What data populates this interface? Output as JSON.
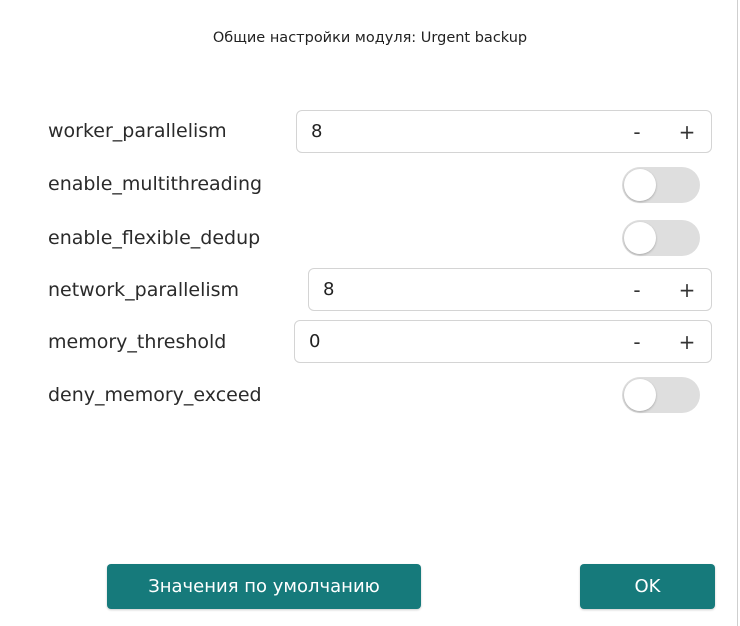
{
  "dialog": {
    "title": "Общие настройки модуля: Urgent backup"
  },
  "settings": [
    {
      "key": "worker_parallelism",
      "label": "worker_parallelism",
      "type": "stepper",
      "value": "8",
      "minus": "-",
      "plus": "+"
    },
    {
      "key": "enable_multithreading",
      "label": "enable_multithreading",
      "type": "toggle",
      "on": false
    },
    {
      "key": "enable_flexible_dedup",
      "label": "enable_flexible_dedup",
      "type": "toggle",
      "on": false
    },
    {
      "key": "network_parallelism",
      "label": "network_parallelism",
      "type": "stepper",
      "value": "8",
      "minus": "-",
      "plus": "+"
    },
    {
      "key": "memory_threshold",
      "label": "memory_threshold",
      "type": "stepper",
      "value": "0",
      "minus": "-",
      "plus": "+"
    },
    {
      "key": "deny_memory_exceed",
      "label": "deny_memory_exceed",
      "type": "toggle",
      "on": false
    }
  ],
  "buttons": {
    "defaults_label": "Значения по умолчанию",
    "ok_label": "OK"
  },
  "colors": {
    "accent": "#167a7b",
    "toggle_off": "#dedede"
  }
}
